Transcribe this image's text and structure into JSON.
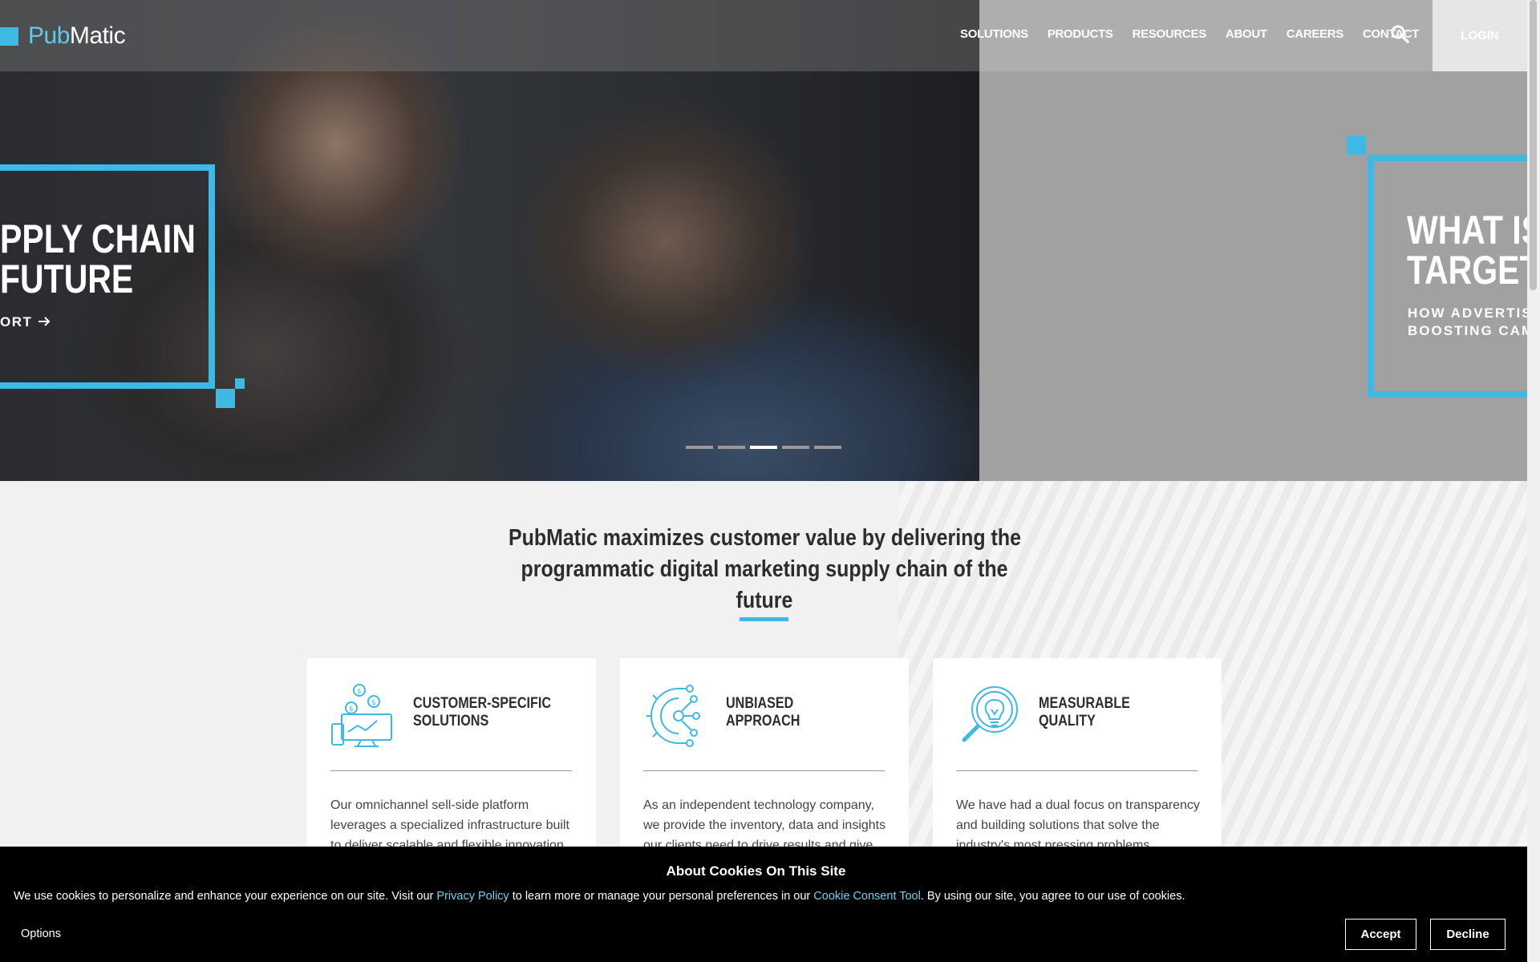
{
  "brand": {
    "logo_text_pub": "Pub",
    "logo_text_matic": "Matic",
    "accent_color": "#3fb9e3"
  },
  "nav": {
    "items": [
      "SOLUTIONS",
      "PRODUCTS",
      "RESOURCES",
      "ABOUT",
      "CAREERS",
      "CONTACT"
    ],
    "search_icon": "search-icon",
    "login_label": "LOGIN"
  },
  "hero": {
    "left_slide": {
      "title_line1": "PPLY CHAIN",
      "title_line2": "FUTURE",
      "link_text": "ORT"
    },
    "right_slide": {
      "title_line1": "WHAT IS",
      "title_line2": "TARGET",
      "subtitle_line1": "HOW ADVERTIS",
      "subtitle_line2": "BOOSTING CAM"
    },
    "slider": {
      "count": 5,
      "active_index": 2
    }
  },
  "main": {
    "tagline_line1": "PubMatic maximizes customer value by delivering the",
    "tagline_line2": "programmatic digital marketing supply chain of the future"
  },
  "cards": [
    {
      "icon": "devices-money-icon",
      "title_line1": "CUSTOMER-SPECIFIC",
      "title_line2": "SOLUTIONS",
      "body": "Our omnichannel sell-side platform leverages a specialized infrastructure built to deliver scalable and flexible innovation"
    },
    {
      "icon": "gear-network-icon",
      "title_line1": "UNBIASED",
      "title_line2": "APPROACH",
      "body": "As an independent technology company, we provide the inventory, data and insights our clients need to drive results and give"
    },
    {
      "icon": "lightbulb-magnifier-icon",
      "title_line1": "MEASURABLE",
      "title_line2": "QUALITY",
      "body": "We have had a dual focus on transparency and building solutions that solve the industry's most pressing problems."
    }
  ],
  "cookie": {
    "title": "About Cookies On This Site",
    "text_before": "We use cookies to personalize and enhance your experience on our site. Visit our ",
    "privacy_link": "Privacy Policy",
    "text_middle": " to learn more or manage your personal preferences in our ",
    "consent_link": "Cookie Consent Tool",
    "text_after": ". By using our site, you agree to our use of cookies.",
    "options_label": "Options",
    "accept_label": "Accept",
    "decline_label": "Decline"
  }
}
